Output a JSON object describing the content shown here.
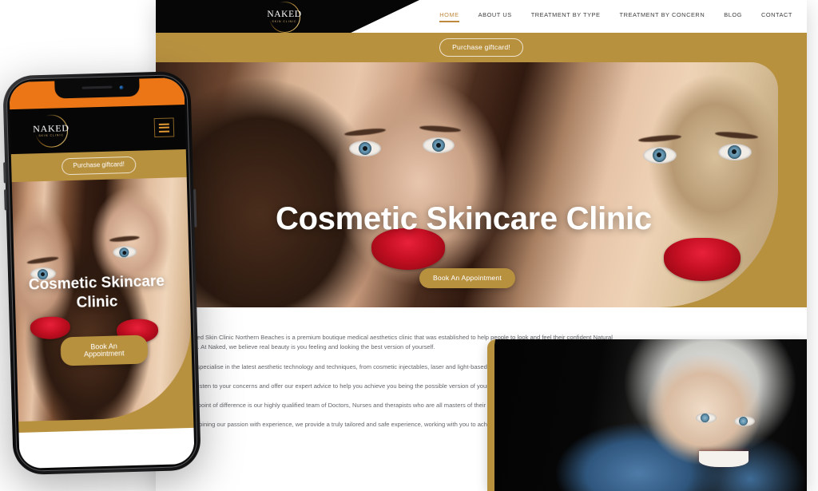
{
  "brand": {
    "logo_name": "NAKED",
    "logo_sub": "SKIN CLINIC",
    "gold": "#B8913F",
    "accent": "#C08A3E",
    "orange": "#EC7615",
    "black": "#060606"
  },
  "desktop": {
    "nav": [
      {
        "label": "HOME",
        "active": true
      },
      {
        "label": "ABOUT US",
        "active": false
      },
      {
        "label": "TREATMENT BY TYPE",
        "active": false
      },
      {
        "label": "TREATMENT BY CONCERN",
        "active": false
      },
      {
        "label": "BLOG",
        "active": false
      },
      {
        "label": "CONTACT",
        "active": false
      }
    ],
    "giftcard_label": "Purchase giftcard!",
    "hero": {
      "title": "Cosmetic Skincare Clinic",
      "cta_label": "Book An Appointment"
    },
    "content": {
      "paragraphs": [
        "Naked Skin Clinic Northern Beaches is a premium boutique medical aesthetics clinic that was established to help people to look and feel their confident Natural best. At Naked, we believe real beauty is you feeling and looking the best version of yourself.",
        "We specialise in the latest aesthetic technology and techniques, from cosmetic injectables, laser and light-based treatments.",
        "We listen to your concerns and offer our expert advice to help you achieve you being the possible version of yourself.",
        "Our point of difference is our highly qualified team of Doctors, Nurses and therapists who are all masters of their craft.",
        "Combining our passion with experience, we provide a truly tailored and safe experience, working with you to achieve your goals."
      ]
    }
  },
  "phone": {
    "giftcard_label": "Purchase giftcard!",
    "hero": {
      "title": "Cosmetic Skincare Clinic",
      "cta_label": "Book An Appointment"
    }
  }
}
